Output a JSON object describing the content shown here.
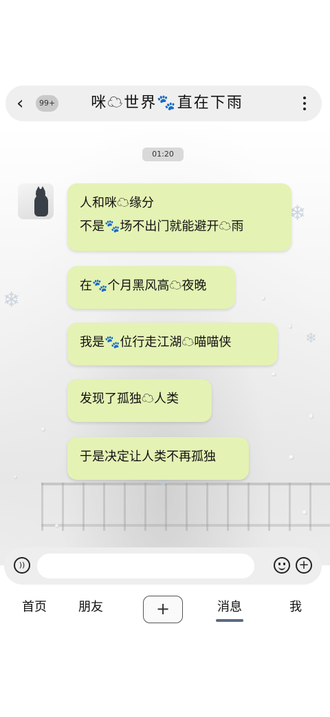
{
  "header": {
    "back_icon": "chevron-left-icon",
    "unread_badge": "99+",
    "title": "咪☁世界🐾直在下雨",
    "more_icon": "more-vertical-icon"
  },
  "chat": {
    "timestamp": "01:20",
    "messages": [
      {
        "lines": [
          "人和咪☁缘分",
          "不是🐾场不出门就能避开☁雨"
        ]
      },
      {
        "lines": [
          "在🐾个月黑风高☁夜晚"
        ]
      },
      {
        "lines": [
          "我是🐾位行走江湖☁喵喵侠"
        ]
      },
      {
        "lines": [
          "发现了孤独☁人类"
        ]
      },
      {
        "lines": [
          "于是决定让人类不再孤独"
        ]
      }
    ]
  },
  "input": {
    "value": "",
    "placeholder": "",
    "voice_icon": "voice-icon",
    "emoji_icon": "emoji-icon",
    "add_icon": "plus-circle-icon"
  },
  "nav": {
    "home": "首页",
    "friends": "朋友",
    "add": "+",
    "messages": "消息",
    "me": "我"
  },
  "colors": {
    "bubble": "#e4f2b4",
    "header_bg": "#efefef",
    "nav_indicator": "#5a6a80"
  }
}
